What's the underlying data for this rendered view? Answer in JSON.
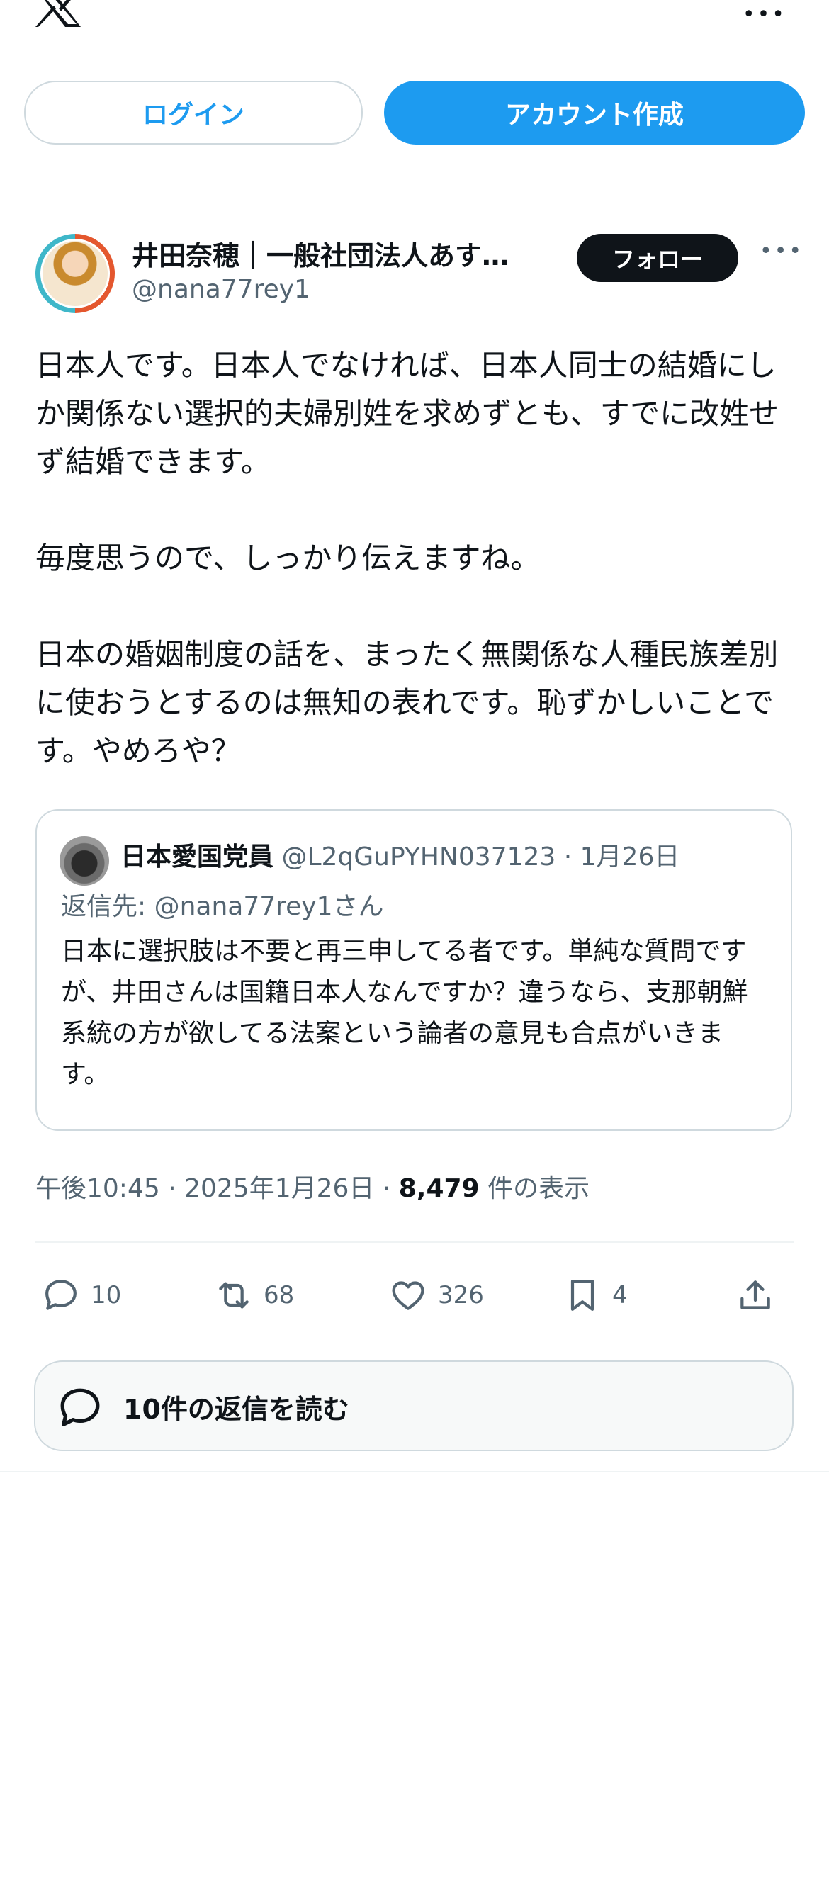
{
  "topbar": {
    "logo_icon": "x-logo-icon",
    "more_label": "•••"
  },
  "auth": {
    "login_label": "ログイン",
    "signup_label": "アカウント作成"
  },
  "post": {
    "author_name": "井田奈穂｜一般社団法人あす…",
    "author_handle": "@nana77rey1",
    "follow_label": "フォロー",
    "more_label": "•••",
    "text": "日本人です。日本人でなければ、日本人同士の結婚にしか関係ない選択的夫婦別姓を求めずとも、すでに改姓せず結婚できます。\n\n毎度思うので、しっかり伝えますね。\n\n日本の婚姻制度の話を、まったく無関係な人種民族差別に使おうとするのは無知の表れです。恥ずかしいことです。やめろや？",
    "quote": {
      "name": "日本愛国党員",
      "meta": " @L2qGuPYHN037123 · 1月26日",
      "reply_to": "返信先: @nana77rey1さん",
      "text": "日本に選択肢は不要と再三申してる者です。単純な質問ですが、井田さんは国籍日本人なんですか？違うなら、支那朝鮮系統の方が欲してる法案という論者の意見も合点がいきます。"
    },
    "time": "午後10:45 · 2025年1月26日 · ",
    "views_count": "8,479",
    "views_label": " 件の表示"
  },
  "actions": {
    "replies": "10",
    "reposts": "68",
    "likes": "326",
    "bookmarks": "4"
  },
  "read_replies_label": "10件の返信を読む",
  "colors": {
    "accent": "#1d9bf0",
    "text": "#0f1419",
    "muted": "#536471",
    "border": "#cfd9de"
  }
}
